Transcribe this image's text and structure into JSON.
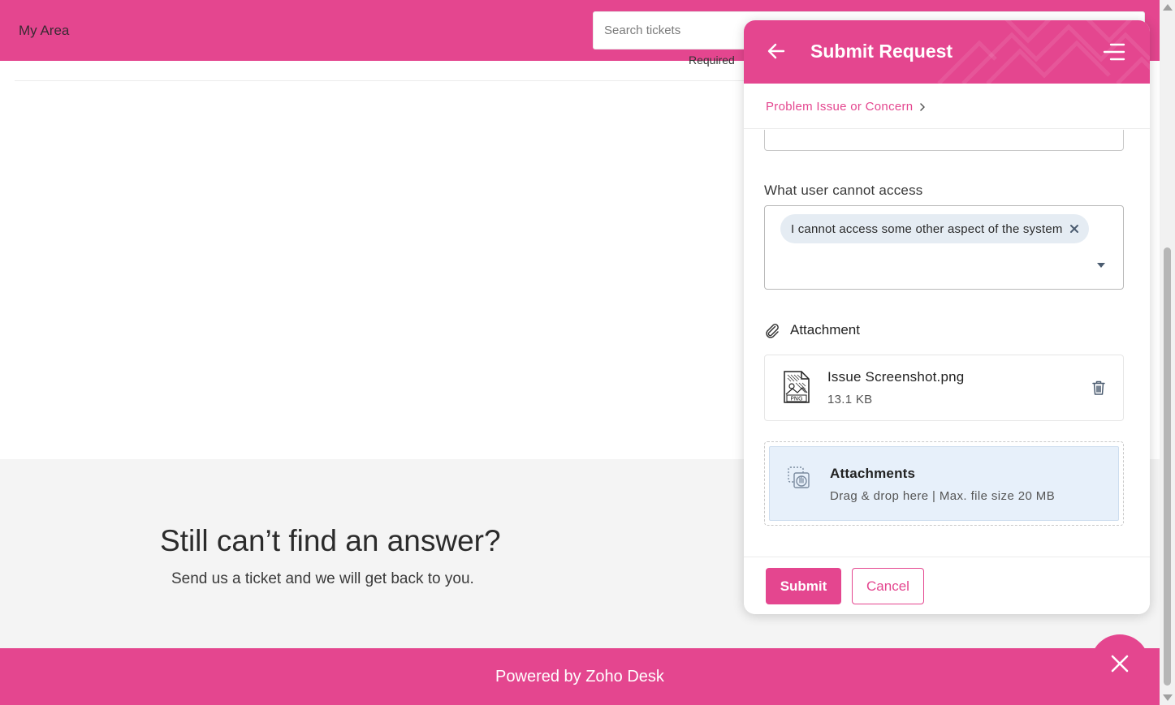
{
  "header": {
    "brand": "My Area",
    "search_placeholder": "Search tickets"
  },
  "background": {
    "partial_label": "Required"
  },
  "help_section": {
    "title": "Still can’t find an answer?",
    "subtitle": "Send us a ticket and we will get back to you."
  },
  "footer": {
    "text": "Powered by Zoho Desk"
  },
  "panel": {
    "title": "Submit Request",
    "breadcrumb": "Problem Issue or Concern",
    "access_field": {
      "label": "What user cannot access",
      "selected": [
        "I cannot access some other aspect of the system"
      ]
    },
    "attachment": {
      "section_label": "Attachment",
      "file": {
        "name": "Issue Screenshot.png",
        "size": "13.1 KB",
        "type_badge": "PNG"
      },
      "dropzone": {
        "title": "Attachments",
        "subtitle": "Drag & drop here | Max. file size 20 MB"
      }
    },
    "actions": {
      "submit": "Submit",
      "cancel": "Cancel"
    }
  },
  "colors": {
    "brand": "#e4468f",
    "dropzone_bg": "#e7f0fa",
    "chip_bg": "#e5ecf3"
  }
}
